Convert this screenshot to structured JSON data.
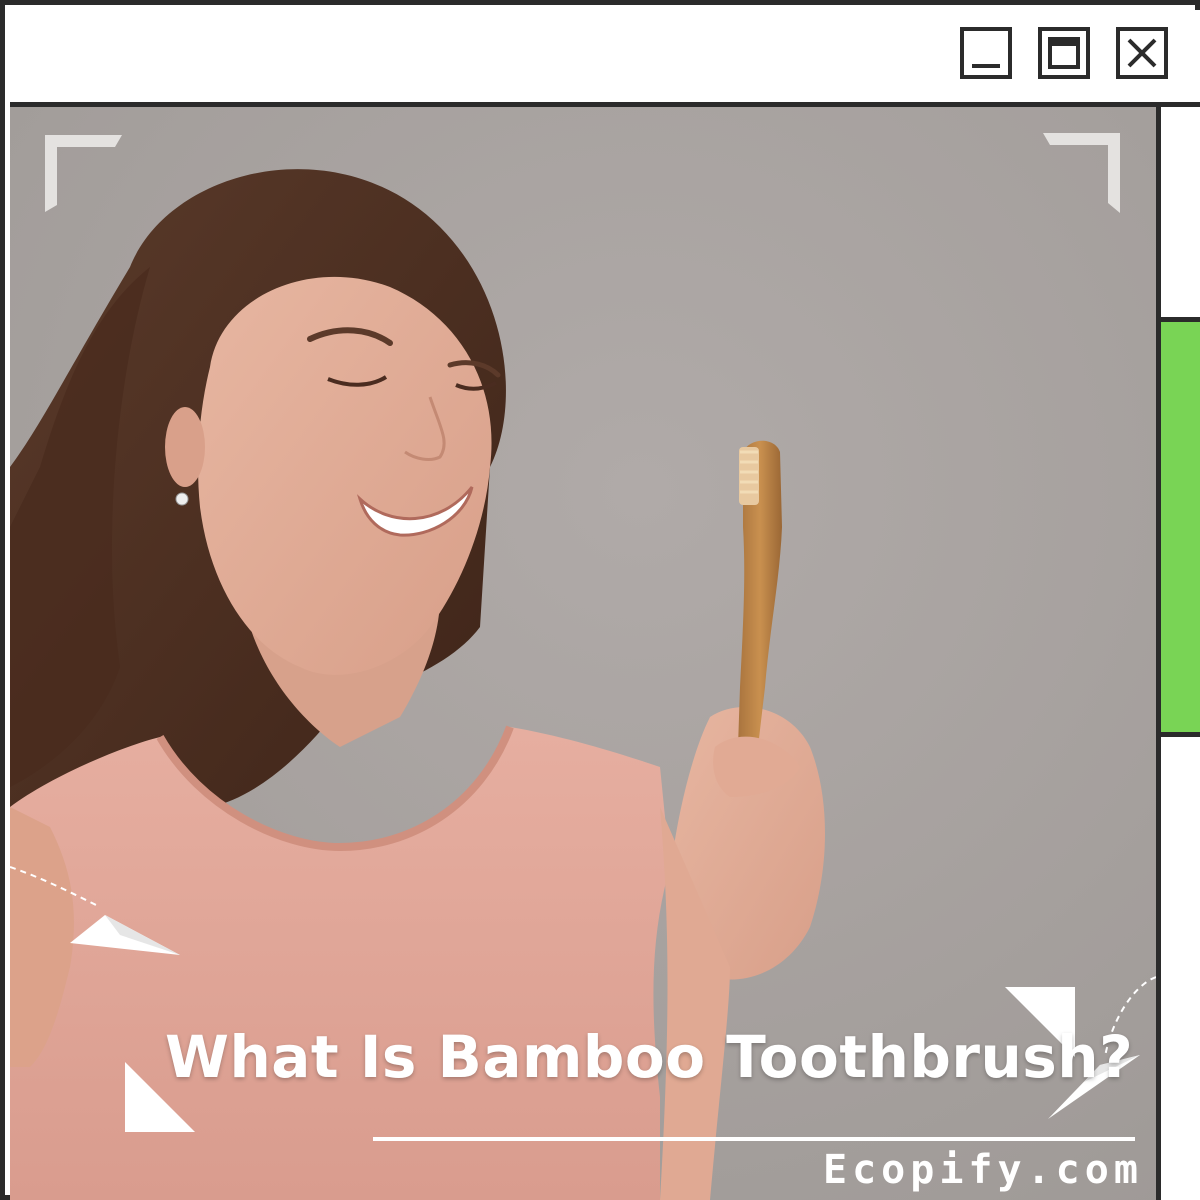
{
  "window": {
    "controls": {
      "minimize_icon": "minimize-icon",
      "maximize_icon": "maximize-icon",
      "close_icon": "close-icon"
    }
  },
  "content": {
    "image": "woman-holding-bamboo-toothbrush",
    "headline": "What Is Bamboo Toothbrush?",
    "site": "Ecopify.com"
  },
  "scrollbar": {
    "thumb_color": "#79d455"
  },
  "colors": {
    "border": "#2b2b2b",
    "background": "#aba6a4",
    "accent": "#79d455",
    "text": "#ffffff"
  }
}
